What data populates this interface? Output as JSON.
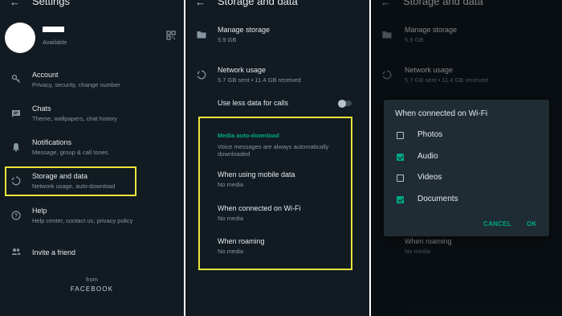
{
  "settings": {
    "title": "Settings",
    "back_icon": "arrow-left-icon",
    "profile": {
      "status": "Available",
      "qr_icon": "qr-code-icon"
    },
    "items": [
      {
        "label": "Account",
        "sub": "Privacy, security, change number",
        "icon": "key-icon"
      },
      {
        "label": "Chats",
        "sub": "Theme, wallpapers, chat history",
        "icon": "chat-icon"
      },
      {
        "label": "Notifications",
        "sub": "Message, group & call tones",
        "icon": "bell-icon"
      },
      {
        "label": "Storage and data",
        "sub": "Network usage, auto-download",
        "icon": "storage-icon"
      },
      {
        "label": "Help",
        "sub": "Help center, contact us, privacy policy",
        "icon": "help-icon"
      },
      {
        "label": "Invite a friend",
        "sub": "",
        "icon": "people-icon"
      }
    ],
    "footer_from": "from",
    "footer_brand": "FACEBOOK"
  },
  "storage": {
    "title": "Storage and data",
    "manage": {
      "label": "Manage storage",
      "sub": "5.9 GB"
    },
    "network": {
      "label": "Network usage",
      "sub": "5.7 GB sent • 11.4 GB received"
    },
    "less_data": {
      "label": "Use less data for calls",
      "enabled": false
    },
    "auto_download": {
      "header": "Media auto-download",
      "note": "Voice messages are always automatically downloaded",
      "mobile": {
        "label": "When using mobile data",
        "sub": "No media"
      },
      "wifi": {
        "label": "When connected on Wi-Fi",
        "sub": "No media"
      },
      "roaming": {
        "label": "When roaming",
        "sub": "No media"
      }
    }
  },
  "dialog": {
    "title": "When connected on Wi-Fi",
    "options": [
      {
        "label": "Photos",
        "checked": false
      },
      {
        "label": "Audio",
        "checked": true
      },
      {
        "label": "Videos",
        "checked": false
      },
      {
        "label": "Documents",
        "checked": true
      }
    ],
    "cancel": "CANCEL",
    "ok": "OK"
  },
  "colors": {
    "background": "#121b22",
    "accent": "#00a884",
    "highlight_box": "#e8e53a"
  }
}
